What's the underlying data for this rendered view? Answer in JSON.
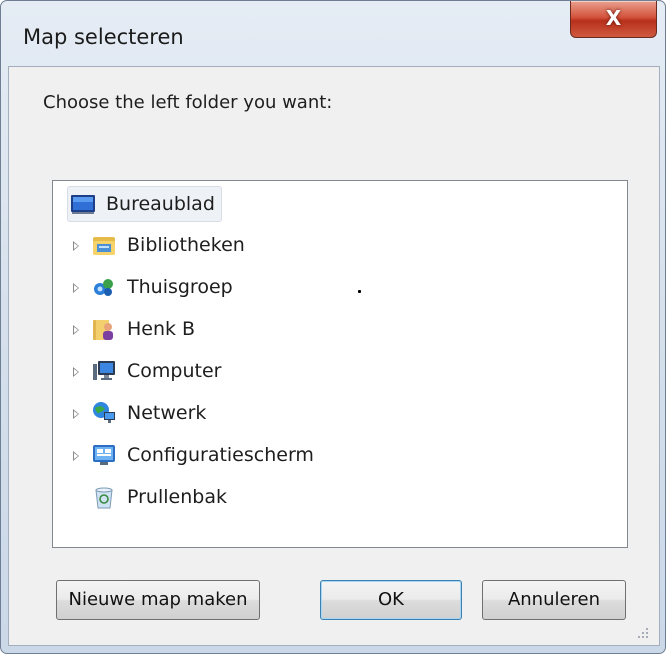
{
  "window": {
    "title": "Map selecteren",
    "close_glyph": "X"
  },
  "prompt": "Choose the left folder you want:",
  "tree": {
    "items": [
      {
        "label": "Bureaublad",
        "icon": "desktop-icon",
        "expandable": false,
        "selected": true
      },
      {
        "label": "Bibliotheken",
        "icon": "libraries-icon",
        "expandable": true
      },
      {
        "label": "Thuisgroep",
        "icon": "homegroup-icon",
        "expandable": true
      },
      {
        "label": "Henk B",
        "icon": "user-folder-icon",
        "expandable": true
      },
      {
        "label": "Computer",
        "icon": "computer-icon",
        "expandable": true
      },
      {
        "label": "Netwerk",
        "icon": "network-icon",
        "expandable": true
      },
      {
        "label": "Configuratiescherm",
        "icon": "control-panel-icon",
        "expandable": true
      },
      {
        "label": "Prullenbak",
        "icon": "recycle-bin-icon",
        "expandable": false
      }
    ]
  },
  "buttons": {
    "new_folder": "Nieuwe map maken",
    "ok": "OK",
    "cancel": "Annuleren"
  }
}
